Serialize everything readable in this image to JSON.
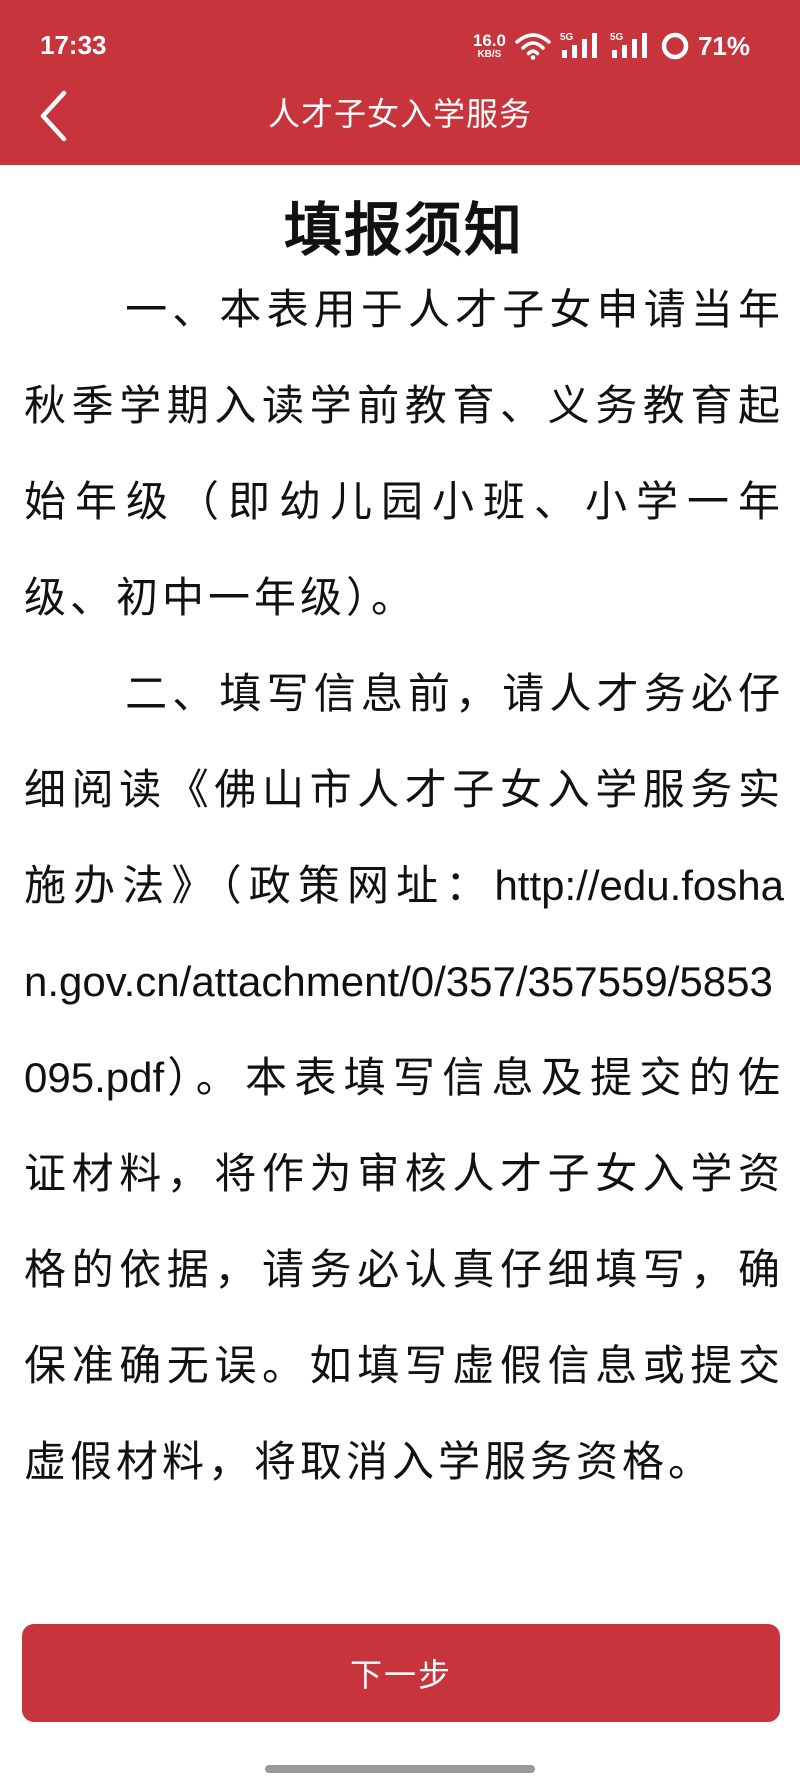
{
  "status_bar": {
    "time": "17:33",
    "net_speed_value": "16.0",
    "net_speed_unit": "KB/S",
    "signal1_tag": "5G",
    "signal2_tag": "5G",
    "battery_percent": "71%"
  },
  "nav": {
    "title": "人才子女入学服务",
    "back_icon": "chevron-left-icon"
  },
  "notice": {
    "title": "填报须知",
    "para1": "一、本表用于人才子女申请当年秋季学期入读学前教育、义务教育起始年级（即幼儿园小班、小学一年级、初中一年级）。",
    "para2_a": "二、填写信息前，请人才务必仔细阅读《佛山市人才子女入学服务实施办法》（政策网址：",
    "para2_url": "http://edu.foshan.gov.cn/attachment/0/357/357559/5853095.pdf",
    "para2_b": "）。本表填写信息及提交的佐证材料，将作为审核人才子女入学资格的依据，请务必认真仔细填写，确保准确无误。如填写虚假信息或提交虚假材料，将取消入学服务资格。"
  },
  "footer": {
    "next_label": "下一步"
  },
  "colors": {
    "brand_red": "#c8343c",
    "text": "#111111",
    "background": "#ffffff"
  }
}
